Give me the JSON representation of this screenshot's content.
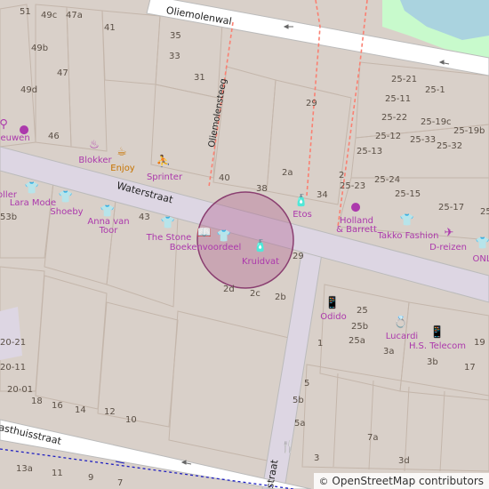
{
  "map": {
    "colors": {
      "building": "#d9d0c9",
      "building_outline": "#c4b6ab",
      "road": "#ffffff",
      "road_casing": "#bbbbbb",
      "pedestrian": "#ddd6e3",
      "water": "#aad3df",
      "park": "#c8facc",
      "footway": "#fa8072",
      "shop_label": "#ac39ac",
      "food_label": "#c77400",
      "highlight": "#b06090"
    },
    "streets": [
      {
        "id": "oliemolenwal",
        "name": "Oliemolenwal"
      },
      {
        "id": "oliemolensteeg",
        "name": "Oliemolensteeg"
      },
      {
        "id": "waterstraat",
        "name": "Waterstraat"
      },
      {
        "id": "gasthuisstraat",
        "name": "asthuisstraat"
      },
      {
        "id": "cross",
        "name": "straat"
      }
    ],
    "pois": [
      {
        "id": "blokker",
        "name": "Blokker",
        "kind": "shop",
        "icon": "household-icon",
        "glyph": "♨"
      },
      {
        "id": "enjoy",
        "name": "Enjoy",
        "kind": "food",
        "icon": "coffee-icon",
        "glyph": "☕"
      },
      {
        "id": "sprinter",
        "name": "Sprinter",
        "kind": "shop",
        "icon": "sports-icon",
        "glyph": "⛹"
      },
      {
        "id": "etos",
        "name": "Etos",
        "kind": "shop",
        "icon": "chemist-icon",
        "glyph": "🧴"
      },
      {
        "id": "holland-barrett",
        "name": "Holland\n& Barrett",
        "kind": "shop",
        "icon": "dot-icon",
        "glyph": "●"
      },
      {
        "id": "takko",
        "name": "Takko Fashion",
        "kind": "shop",
        "icon": "clothes-icon",
        "glyph": "👕"
      },
      {
        "id": "dreizen",
        "name": "D-reizen",
        "kind": "shop",
        "icon": "travel-icon",
        "glyph": "✈"
      },
      {
        "id": "only",
        "name": "ONL",
        "kind": "shop",
        "icon": "clothes-icon",
        "glyph": "👕"
      },
      {
        "id": "lara-mode",
        "name": "Lara Mode",
        "kind": "shop",
        "icon": "clothes-icon",
        "glyph": "👕"
      },
      {
        "id": "shoeby",
        "name": "Shoeby",
        "kind": "shop",
        "icon": "clothes-icon",
        "glyph": "👕"
      },
      {
        "id": "anna-van-toor",
        "name": "Anna van\nToor",
        "kind": "shop",
        "icon": "clothes-icon",
        "glyph": "👕"
      },
      {
        "id": "the-stone",
        "name": "The Stone",
        "kind": "shop",
        "icon": "clothes-icon",
        "glyph": "👕"
      },
      {
        "id": "boekenvoordeel",
        "name": "Boekenvoordeel",
        "kind": "shop",
        "icon": "book-icon",
        "glyph": "📖"
      },
      {
        "id": "kruidvat",
        "name": "Kruidvat",
        "kind": "shop",
        "icon": "chemist-icon",
        "glyph": "🧴"
      },
      {
        "id": "odido",
        "name": "Odido",
        "kind": "shop",
        "icon": "phone-icon",
        "glyph": "📱"
      },
      {
        "id": "lucardi",
        "name": "Lucardi",
        "kind": "shop",
        "icon": "jewelry-icon",
        "glyph": "💍"
      },
      {
        "id": "hs-telecom",
        "name": "H.S. Telecom",
        "kind": "shop",
        "icon": "phone-icon",
        "glyph": "📱"
      },
      {
        "id": "leeuwen",
        "name": "eeuwen",
        "kind": "shop",
        "icon": "dot-icon",
        "glyph": "●"
      },
      {
        "id": "oller",
        "name": "oller",
        "kind": "shop",
        "icon": "clothes-icon",
        "glyph": "👕"
      },
      {
        "id": "restaurant",
        "name": "",
        "kind": "food",
        "icon": "restaurant-icon",
        "glyph": "🍴"
      },
      {
        "id": "bike",
        "name": "",
        "kind": "shop",
        "icon": "bicycle-icon",
        "glyph": "⚲"
      }
    ],
    "house_numbers": [
      "51",
      "49c",
      "47a",
      "49b",
      "41",
      "35",
      "33",
      "49d",
      "47",
      "31",
      "46",
      "29",
      "40",
      "2a",
      "38",
      "34",
      "2",
      "25-21",
      "25-11",
      "25-1",
      "25-22",
      "25-19c",
      "25-12",
      "25-19b",
      "25-33",
      "25-32",
      "25-13",
      "25-23",
      "25-24",
      "25-15",
      "25-17",
      "25-",
      "53b",
      "43",
      "29",
      "2d",
      "2c",
      "2b",
      "25",
      "25b",
      "25a",
      "1",
      "3a",
      "3b",
      "17",
      "19",
      "20-21",
      "20-11",
      "20-01",
      "18",
      "16",
      "14",
      "12",
      "10",
      "5",
      "5b",
      "5a",
      "7a",
      "3",
      "3d",
      "13a",
      "11",
      "9",
      "7"
    ],
    "attribution": {
      "symbol": "©",
      "text": "OpenStreetMap contributors"
    }
  }
}
